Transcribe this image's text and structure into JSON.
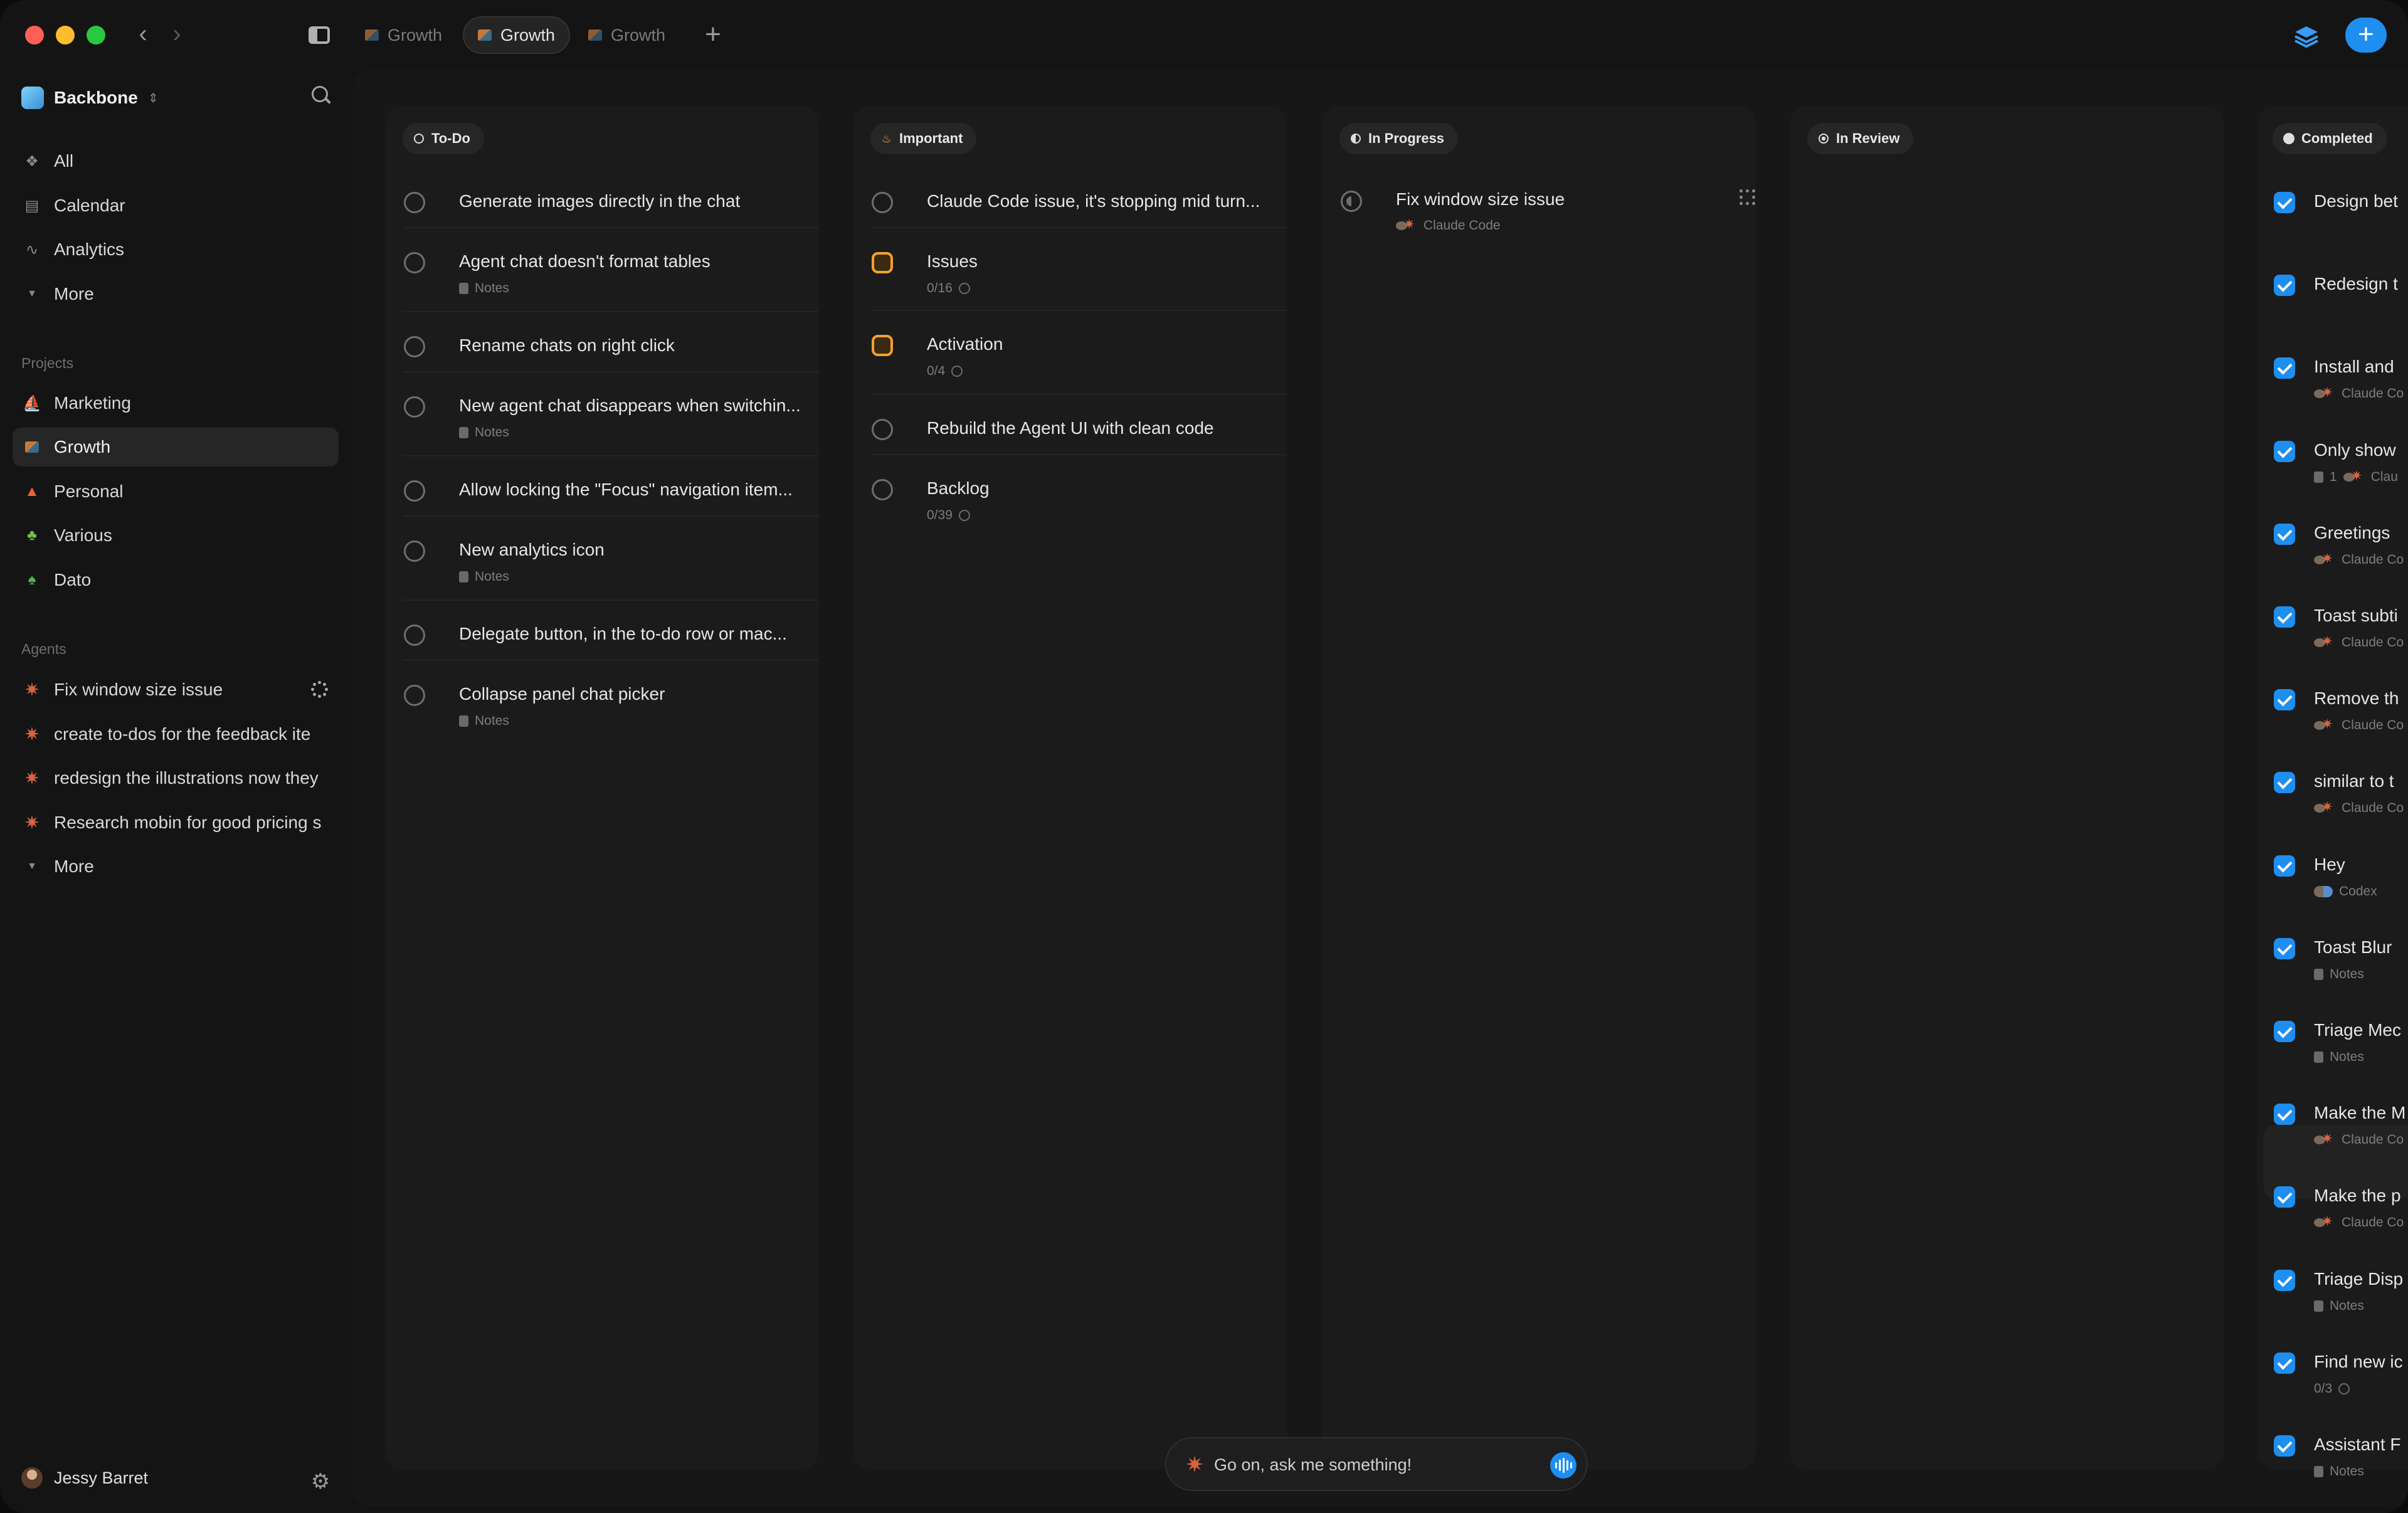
{
  "tabs": [
    {
      "label": "Growth",
      "active": false
    },
    {
      "label": "Growth",
      "active": true
    },
    {
      "label": "Growth",
      "active": false
    }
  ],
  "workspace": {
    "name": "Backbone"
  },
  "nav": [
    {
      "label": "All",
      "icon": "shortcut-icon"
    },
    {
      "label": "Calendar",
      "icon": "calendar-icon"
    },
    {
      "label": "Analytics",
      "icon": "analytics-icon"
    },
    {
      "label": "More",
      "icon": "chevron-down-icon"
    }
  ],
  "projects_label": "Projects",
  "projects": [
    {
      "label": "Marketing",
      "icon": "sailboat-icon",
      "active": false
    },
    {
      "label": "Growth",
      "icon": "growth-icon",
      "active": true
    },
    {
      "label": "Personal",
      "icon": "tent-icon",
      "active": false
    },
    {
      "label": "Various",
      "icon": "plant-icon",
      "active": false
    },
    {
      "label": "Dato",
      "icon": "palm-tree-icon",
      "active": false
    }
  ],
  "agents_label": "Agents",
  "agents": [
    {
      "label": "Fix window size issue",
      "running": true
    },
    {
      "label": "create to-dos for the feedback ite",
      "running": false
    },
    {
      "label": "redesign the illustrations now they",
      "running": false
    },
    {
      "label": "Research mobin for good pricing s",
      "running": false
    }
  ],
  "agents_more": "More",
  "user": {
    "name": "Jessy Barret"
  },
  "columns": {
    "todo": {
      "title": "To-Do",
      "cards": [
        {
          "title": "Generate images directly in the chat"
        },
        {
          "title": "Agent chat doesn't format tables",
          "meta": "Notes"
        },
        {
          "title": "Rename chats on right click"
        },
        {
          "title": "New agent chat disappears when switchin...",
          "meta": "Notes"
        },
        {
          "title": "Allow locking the \"Focus\" navigation item..."
        },
        {
          "title": "New analytics icon",
          "meta": "Notes"
        },
        {
          "title": "Delegate button, in the to-do row or mac..."
        },
        {
          "title": "Collapse panel chat picker",
          "meta": "Notes"
        }
      ]
    },
    "important": {
      "title": "Important",
      "cards": [
        {
          "title": "Claude Code issue, it's stopping mid turn..."
        },
        {
          "title": "Issues",
          "meta": "0/16"
        },
        {
          "title": "Activation",
          "meta": "0/4"
        },
        {
          "title": "Rebuild the Agent UI with clean code"
        },
        {
          "title": "Backlog",
          "meta": "0/39"
        }
      ]
    },
    "in_progress": {
      "title": "In Progress",
      "cards": [
        {
          "title": "Fix window size issue",
          "meta": "Claude Code"
        }
      ]
    },
    "in_review": {
      "title": "In Review",
      "cards": []
    },
    "completed": {
      "title": "Completed",
      "cards": [
        {
          "title": "Design bet"
        },
        {
          "title": "Redesign t"
        },
        {
          "title": "Install and",
          "meta": "Claude Co"
        },
        {
          "title": "Only show",
          "meta_count": "1",
          "meta": "Clau"
        },
        {
          "title": "Greetings",
          "meta": "Claude Co"
        },
        {
          "title": "Toast subti",
          "meta": "Claude Co"
        },
        {
          "title": "Remove th",
          "meta": "Claude Co"
        },
        {
          "title": "similar to t",
          "meta": "Claude Co"
        },
        {
          "title": "Hey",
          "meta": "Codex"
        },
        {
          "title": "Toast Blur",
          "meta": "Notes"
        },
        {
          "title": "Triage Mec",
          "meta": "Notes"
        },
        {
          "title": "Make the M",
          "meta": "Claude Co"
        },
        {
          "title": "Make the p",
          "meta": "Claude Co"
        },
        {
          "title": "Triage Disp",
          "meta": "Notes"
        },
        {
          "title": "Find new ic",
          "meta": "0/3"
        },
        {
          "title": "Assistant F",
          "meta": "Notes"
        }
      ]
    }
  },
  "composer": {
    "placeholder": "Go on, ask me something!"
  },
  "colors": {
    "accent": "#1e8ef0",
    "important": "#f5a12c",
    "claude": "#d8643f"
  }
}
